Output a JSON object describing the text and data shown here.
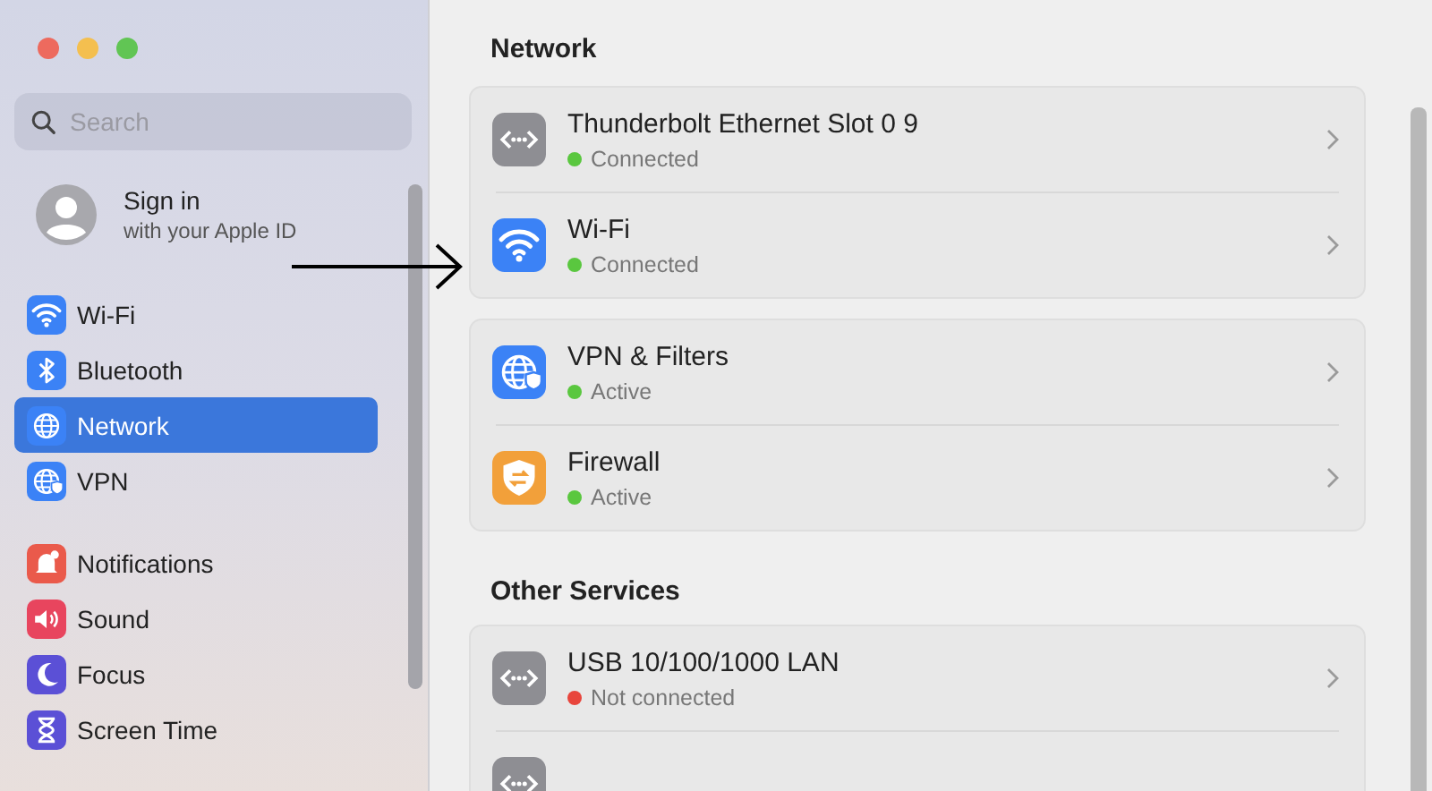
{
  "window": {
    "controls": [
      {
        "kind": "close"
      },
      {
        "kind": "minimize"
      },
      {
        "kind": "zoom"
      }
    ]
  },
  "sidebar": {
    "search": {
      "placeholder": "Search"
    },
    "account": {
      "title": "Sign in",
      "subtitle": "with your Apple ID"
    },
    "groups": [
      [
        {
          "label": "Wi-Fi",
          "kind": "wifi",
          "selected": false
        },
        {
          "label": "Bluetooth",
          "kind": "bluetooth",
          "selected": false
        },
        {
          "label": "Network",
          "kind": "globe",
          "selected": true
        },
        {
          "label": "VPN",
          "kind": "vpn",
          "selected": false
        }
      ],
      [
        {
          "label": "Notifications",
          "kind": "bell",
          "selected": false
        },
        {
          "label": "Sound",
          "kind": "speaker",
          "selected": false
        },
        {
          "label": "Focus",
          "kind": "moon",
          "selected": false
        },
        {
          "label": "Screen Time",
          "kind": "hourglass",
          "selected": false
        }
      ]
    ]
  },
  "main": {
    "title": "Network",
    "cards": [
      [
        {
          "name": "Thunderbolt Ethernet Slot 0 9",
          "status": "Connected",
          "color": "#5ac73f",
          "kind": "ethernet"
        },
        {
          "name": "Wi-Fi",
          "status": "Connected",
          "color": "#5ac73f",
          "kind": "wifi"
        }
      ],
      [
        {
          "name": "VPN & Filters",
          "status": "Active",
          "color": "#5ac73f",
          "kind": "vpn"
        },
        {
          "name": "Firewall",
          "status": "Active",
          "color": "#5ac73f",
          "kind": "firewall"
        }
      ]
    ],
    "other_services": {
      "heading": "Other Services",
      "rows": [
        {
          "name": "USB 10/100/1000 LAN",
          "status": "Not connected",
          "color": "#e8453c",
          "kind": "ethernet"
        },
        {
          "kind": "ethernet"
        }
      ]
    }
  },
  "annotation": {
    "kind": "arrow"
  }
}
